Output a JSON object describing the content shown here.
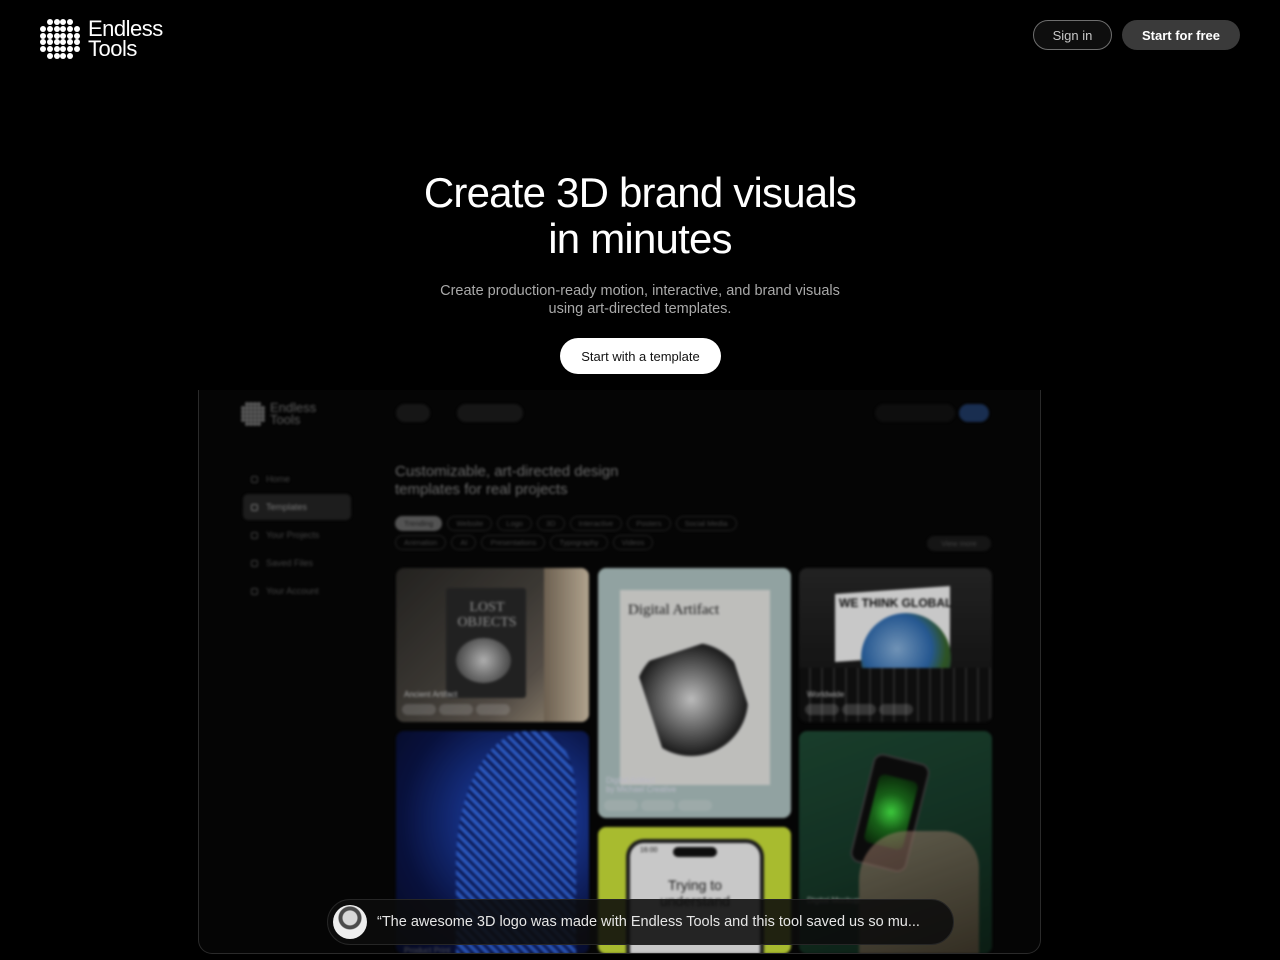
{
  "header": {
    "logo_line1": "Endless",
    "logo_line2": "Tools",
    "signin_label": "Sign in",
    "start_free_label": "Start for free"
  },
  "hero": {
    "title_line1": "Create 3D brand visuals",
    "title_line2": "in minutes",
    "subtitle_line1": "Create production-ready motion, interactive, and brand visuals",
    "subtitle_line2": "using art-directed templates.",
    "cta_label": "Start with a template"
  },
  "preview": {
    "logo_line1": "Endless",
    "logo_line2": "Tools",
    "nav": [
      "Home",
      "Templates",
      "Your Projects",
      "Saved Files",
      "Your Account"
    ],
    "heading_line1": "Customizable, art-directed design",
    "heading_line2": "templates for real projects",
    "chips": [
      "Trending",
      "Website",
      "Logo",
      "3D",
      "Interactive",
      "Posters",
      "Social Media",
      "Animation",
      "AI",
      "Presentations",
      "Typography",
      "Videos"
    ],
    "view_more": "View more",
    "cards": {
      "c1_title": "Ancient Artifact",
      "c1_poster": "LOST OBJECTS",
      "c2_poster_title": "Digital Artifact",
      "c2_title_line1": "Digital Artifact",
      "c2_title_line2": "by Michael Creative",
      "c3_banner": "WE THINK GLOBAL",
      "c3_title": "Worldwide",
      "c5_phone_text": "Trying to understand",
      "c5_time": "16:00",
      "c6_title": "Digital Mockup",
      "c7_title": "Product Print"
    }
  },
  "testimonial": {
    "quote": "“The awesome 3D logo was made with Endless Tools and this tool saved us so mu..."
  }
}
